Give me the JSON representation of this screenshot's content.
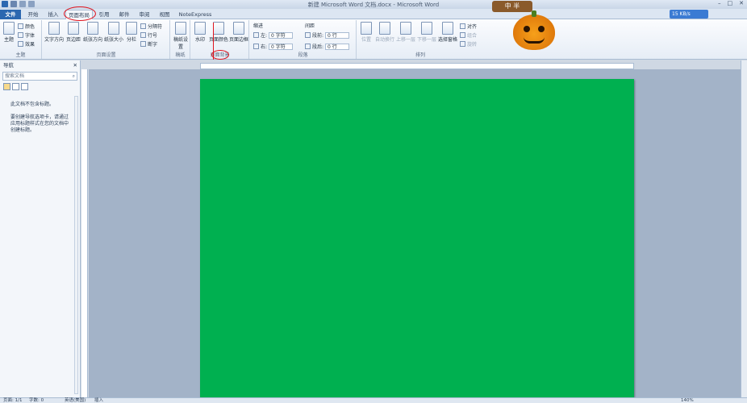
{
  "window": {
    "title": "新建 Microsoft Word 文档.docx - Microsoft Word",
    "network_speed": "15 KB/s"
  },
  "tabs": [
    {
      "label": "文件"
    },
    {
      "label": "开始"
    },
    {
      "label": "插入"
    },
    {
      "label": "页面布局"
    },
    {
      "label": "引用"
    },
    {
      "label": "邮件"
    },
    {
      "label": "审阅"
    },
    {
      "label": "视图"
    },
    {
      "label": "NoteExpress"
    }
  ],
  "ribbon": {
    "themes": {
      "label": "主题",
      "big": "主题",
      "colors": "颜色",
      "fonts": "字体",
      "effects": "效果"
    },
    "page_setup": {
      "label": "页面设置",
      "text_direction": "文字方向",
      "margins": "页边距",
      "orientation": "纸张方向",
      "size": "纸张大小",
      "columns": "分栏",
      "breaks": "分隔符",
      "line_numbers": "行号",
      "hyphenation": "断字"
    },
    "draft": {
      "label": "稿纸",
      "button": "稿纸设置"
    },
    "page_background": {
      "label": "页面背景",
      "watermark": "水印",
      "page_color": "页面颜色",
      "page_borders": "页面边框"
    },
    "paragraph": {
      "label": "段落",
      "indent": "缩进",
      "spacing": "间距",
      "left": "左:",
      "right": "右:",
      "before": "段前:",
      "after": "段后:",
      "left_val": "0 字符",
      "right_val": "0 字符",
      "before_val": "0 行",
      "after_val": "0 行"
    },
    "arrange": {
      "label": "排列",
      "position": "位置",
      "wrap_text": "自动换行",
      "bring_forward": "上移一层",
      "send_backward": "下移一层",
      "selection_pane": "选择窗格",
      "align": "对齐",
      "group": "组合",
      "rotate": "旋转"
    }
  },
  "nav_pane": {
    "title": "导航",
    "search_placeholder": "搜索文档",
    "message1": "此文档不包含标题。",
    "message2": "要创建导航选项卡，请通过应用标题样式在您的文档中创建标题。"
  },
  "status_bar": {
    "page": "页面: 1/1",
    "words": "字数: 0",
    "language": "英语(美国)",
    "mode": "插入",
    "zoom": "140%"
  },
  "decoration": {
    "sign_text": "中 半"
  },
  "colors": {
    "page_background": "#00b050",
    "accent": "#2c67b0",
    "annotation": "#e0141e"
  }
}
